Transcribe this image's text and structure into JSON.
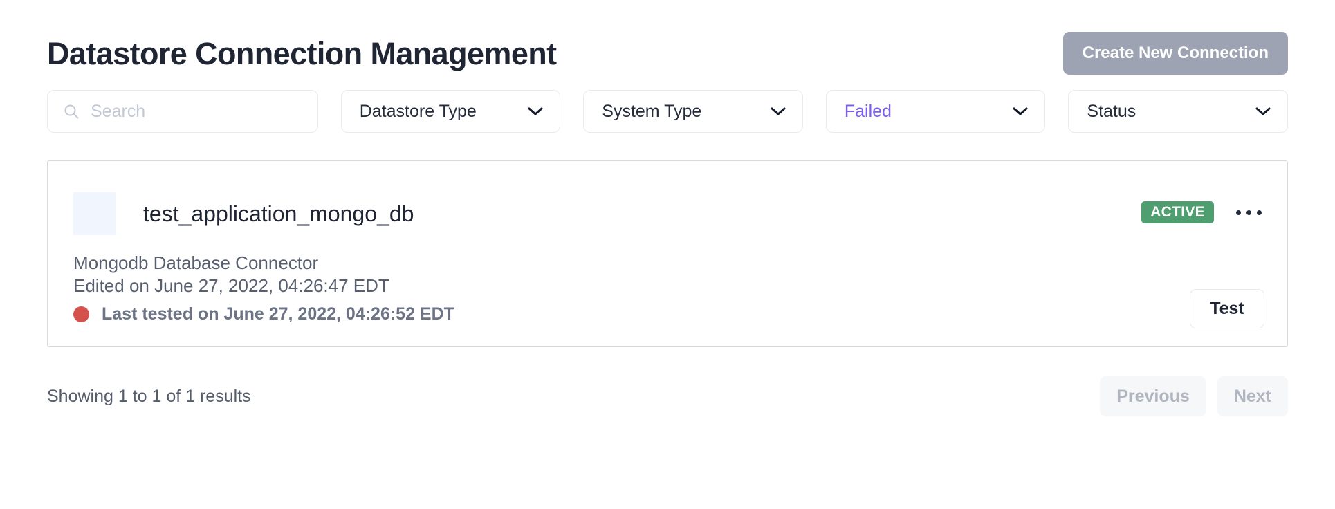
{
  "header": {
    "title": "Datastore Connection Management",
    "create_button": "Create New Connection"
  },
  "filters": {
    "search": {
      "placeholder": "Search",
      "value": ""
    },
    "dropdowns": [
      {
        "label": "Datastore Type",
        "active": false
      },
      {
        "label": "System Type",
        "active": false
      },
      {
        "label": "Failed",
        "active": true
      },
      {
        "label": "Status",
        "active": false
      }
    ]
  },
  "connections": [
    {
      "name": "test_application_mongo_db",
      "badge": "ACTIVE",
      "description": "Mongodb Database Connector",
      "edited": "Edited on June 27, 2022, 04:26:47 EDT",
      "last_tested": "Last tested on June 27, 2022, 04:26:52 EDT",
      "test_button": "Test",
      "menu_icon": "kebab-menu-icon"
    }
  ],
  "footer": {
    "results_text": "Showing 1 to 1 of 1 results",
    "previous": "Previous",
    "next": "Next"
  },
  "colors": {
    "accent_purple": "#7b5cf5",
    "badge_green": "#4e9e6f",
    "status_red": "#d5514c",
    "create_button_gray": "#9da3b2",
    "title_dark": "#1f2533"
  }
}
